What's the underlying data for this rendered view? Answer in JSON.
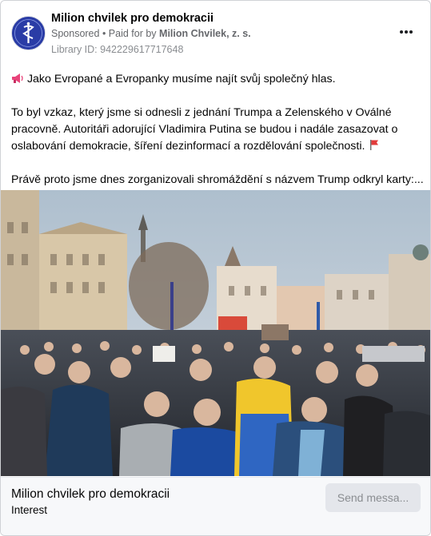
{
  "post": {
    "page_name": "Milion chvilek pro demokracii",
    "sponsored": "Sponsored",
    "dot": " • ",
    "paid_for_prefix": "Paid for by ",
    "paid_for_name": "Milion Chvilek, z. s.",
    "library_id": "Library ID: 942229617717648",
    "paragraph1": "Jako Evropané a Evropanky musíme najít svůj společný hlas.",
    "paragraph2_line1": "To byl vzkaz, který jsme si odnesli z jednání Trumpa a Zelenského v Oválné",
    "paragraph2_line2": "pracovně. Autoritáři adorující Vladimira Putina se budou i nadále zasazovat o",
    "paragraph2_line3": "oslabování demokracie, šíření dezinformací a rozdělování společnosti.",
    "paragraph3": "Právě proto jsme dnes zorganizovali shromáždění s názvem Trump odkryl karty:..."
  },
  "icons": {
    "megaphone": "megaphone-icon",
    "flag": "red-flag-icon",
    "more": "more-options-icon"
  },
  "footer": {
    "title": "Milion chvilek pro demokracii",
    "subtitle": "Interest",
    "button_label": "Send messa..."
  },
  "colors": {
    "avatar_blue": "#2d3fa8",
    "button_bg": "#e4e6eb",
    "muted_text": "#65676b"
  }
}
